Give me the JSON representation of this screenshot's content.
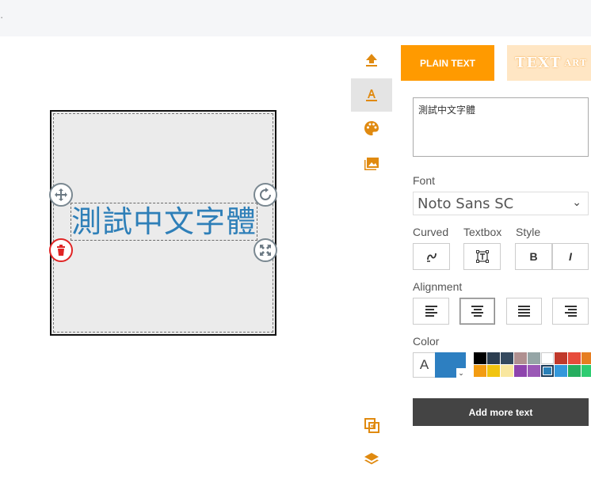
{
  "canvas": {
    "text": "測試中文字體",
    "text_color": "#2e7fb8",
    "handles": {
      "move_icon": "move-icon",
      "rotate_icon": "rotate-icon",
      "delete_icon": "trash-icon",
      "resize_icon": "resize-icon"
    }
  },
  "toolbar": {
    "tools": [
      "upload-icon",
      "text-icon",
      "palette-icon",
      "images-icon",
      "duplicate-icon",
      "layers-icon"
    ],
    "accent": "#e08a10"
  },
  "panel": {
    "tabs": {
      "plain": "PLAIN TEXT",
      "art_main": "TEXT",
      "art_small": "ART"
    },
    "text_value": "測試中文字體",
    "font_label": "Font",
    "font_value": "Noto Sans SC",
    "curved_label": "Curved",
    "textbox_label": "Textbox",
    "style_label": "Style",
    "bold_label": "B",
    "italic_label": "I",
    "alignment_label": "Alignment",
    "color_label": "Color",
    "color_a": "A",
    "selected_color": "#2d7fc1",
    "palette": [
      "#000000",
      "#2c3e50",
      "#34495e",
      "#b09090",
      "#95a5a6",
      "#ffffff",
      "#c0392b",
      "#e74c3c",
      "#e67e22",
      "#f39c12",
      "#f1c40f",
      "#f9e79f",
      "#8e44ad",
      "#9b59b6",
      "#2980b9",
      "#3498db",
      "#27ae60",
      "#2ecc71"
    ],
    "add_button": "Add more text"
  }
}
